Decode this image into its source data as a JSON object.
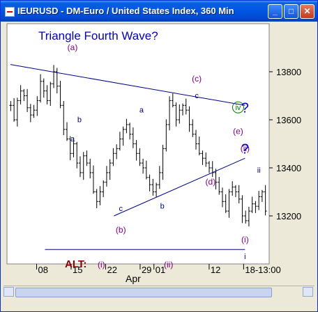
{
  "window": {
    "title": "IEURUSD - DM-Euro / United States Index, 360 Min",
    "minimize": "_",
    "maximize": "□",
    "close": "✕"
  },
  "colors": {
    "plot_bg": "#ffffff",
    "bars": "#000000",
    "trendline": "#00008b",
    "main_count": "#000080",
    "sub_count": "#800080",
    "alt_label": "#8b0000",
    "wave_iv_circle": "#008000",
    "window_chrome": "#ece9d8",
    "titlebar": "#0055e5"
  },
  "chart_data": {
    "type": "ohlc",
    "title": "Triangle Fourth Wave?",
    "ylim": [
      13000,
      14000
    ],
    "y_ticks": [
      13200,
      13400,
      13600,
      13800
    ],
    "x_ticks": [
      "08",
      "15",
      "22",
      "29",
      "01",
      "12",
      "18-13:00"
    ],
    "x_period_label": "Apr",
    "closes": [
      13660,
      13600,
      13680,
      13720,
      13700,
      13650,
      13620,
      13640,
      13680,
      13760,
      13720,
      13680,
      13750,
      13800,
      13740,
      13660,
      13560,
      13520,
      13460,
      13500,
      13420,
      13380,
      13450,
      13420,
      13380,
      13300,
      13260,
      13300,
      13340,
      13380,
      13420,
      13460,
      13480,
      13520,
      13560,
      13580,
      13540,
      13500,
      13460,
      13420,
      13400,
      13360,
      13330,
      13300,
      13330,
      13380,
      13480,
      13580,
      13680,
      13660,
      13600,
      13640,
      13660,
      13640,
      13580,
      13540,
      13500,
      13460,
      13440,
      13420,
      13400,
      13380,
      13340,
      13300,
      13260,
      13220,
      13300,
      13320,
      13300,
      13270,
      13200,
      13180,
      13220,
      13250,
      13240,
      13280,
      13300,
      13220
    ],
    "trendlines": [
      {
        "name": "upper",
        "points": [
          [
            "Mar 3",
            13830
          ],
          [
            "Apr 18",
            13660
          ]
        ]
      },
      {
        "name": "lower",
        "points": [
          [
            "Mar 24",
            13200
          ],
          [
            "Apr 18",
            13440
          ]
        ]
      },
      {
        "name": "alt",
        "points": [
          [
            "Mar 10",
            13060
          ],
          [
            "Apr 18",
            13060
          ]
        ]
      }
    ],
    "wave_labels": [
      {
        "text": "(a)",
        "style": "sub",
        "x": "Mar 15",
        "y": 13890
      },
      {
        "text": "b",
        "style": "main",
        "x": "Mar 17",
        "y": 13590
      },
      {
        "text": "a",
        "style": "main",
        "x": "Mar 16",
        "y": 13510
      },
      {
        "text": "c",
        "style": "main",
        "x": "Mar 25",
        "y": 13220
      },
      {
        "text": "(b)",
        "style": "sub",
        "x": "Mar 25",
        "y": 13130
      },
      {
        "text": "a",
        "style": "main",
        "x": "Mar 30",
        "y": 13630
      },
      {
        "text": "b",
        "style": "main",
        "x": "Apr 2",
        "y": 13230
      },
      {
        "text": "(c)",
        "style": "sub",
        "x": "Apr 9",
        "y": 13760
      },
      {
        "text": "c",
        "style": "main",
        "x": "Apr 9",
        "y": 13690
      },
      {
        "text": "iv",
        "style": "circle",
        "x": "Apr 17",
        "y": 13640
      },
      {
        "text": "?",
        "style": "question",
        "x": "Apr 19",
        "y": 13630
      },
      {
        "text": "(e)",
        "style": "sub",
        "x": "Apr 17",
        "y": 13540
      },
      {
        "text": "(ii)",
        "style": "sub",
        "x": "Apr 19",
        "y": 13470
      },
      {
        "text": "?",
        "style": "question",
        "x": "Apr 20",
        "y": 13460
      },
      {
        "text": "(d)",
        "style": "sub",
        "x": "Apr 13",
        "y": 13330
      },
      {
        "text": "ii",
        "style": "main",
        "x": "Apr 22",
        "y": 13380
      },
      {
        "text": "(i)",
        "style": "sub",
        "x": "Apr 18",
        "y": 13090
      },
      {
        "text": "i",
        "style": "main",
        "x": "Apr 20",
        "y": 13020
      }
    ],
    "alt_count": {
      "label": "ALT:",
      "labels": [
        "(i)",
        "(ii)"
      ]
    }
  }
}
